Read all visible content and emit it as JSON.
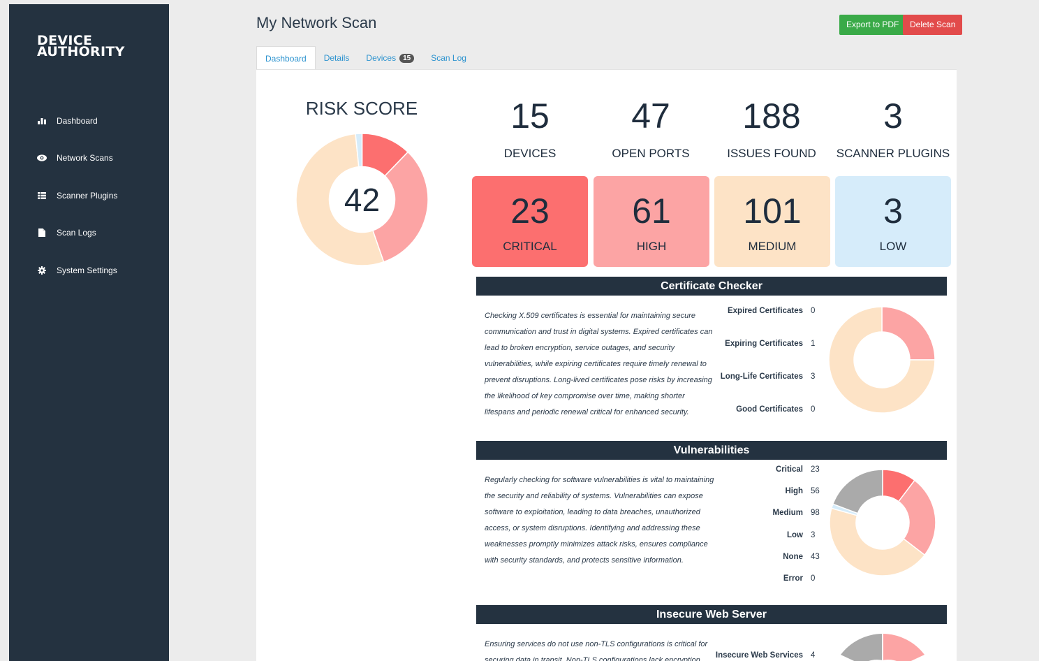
{
  "app": {
    "logo_line1": "DEVICE",
    "logo_line2": "AUTHORITY"
  },
  "sidebar": {
    "items": [
      {
        "label": "Dashboard",
        "icon": "bar-chart-icon"
      },
      {
        "label": "Network Scans",
        "icon": "eye-icon"
      },
      {
        "label": "Scanner Plugins",
        "icon": "list-icon"
      },
      {
        "label": "Scan Logs",
        "icon": "file-icon"
      },
      {
        "label": "System Settings",
        "icon": "gear-icon"
      }
    ]
  },
  "header": {
    "title": "My Network Scan",
    "export_label": "Export to PDF",
    "delete_label": "Delete Scan"
  },
  "tabs": [
    {
      "label": "Dashboard",
      "active": true
    },
    {
      "label": "Details"
    },
    {
      "label": "Devices",
      "badge": "15"
    },
    {
      "label": "Scan Log"
    }
  ],
  "risk": {
    "title": "RISK SCORE",
    "value": "42"
  },
  "stats": [
    {
      "value": "15",
      "label": "DEVICES"
    },
    {
      "value": "47",
      "label": "OPEN PORTS"
    },
    {
      "value": "188",
      "label": "ISSUES FOUND"
    },
    {
      "value": "3",
      "label": "SCANNER PLUGINS"
    }
  ],
  "severity": [
    {
      "value": "23",
      "label": "CRITICAL",
      "color": "#fc6f6f"
    },
    {
      "value": "61",
      "label": "HIGH",
      "color": "#fca4a4"
    },
    {
      "value": "101",
      "label": "MEDIUM",
      "color": "#fde3c6"
    },
    {
      "value": "3",
      "label": "LOW",
      "color": "#d6ecfa"
    }
  ],
  "colors": {
    "critical": "#fc6f6f",
    "high": "#fca4a4",
    "medium": "#fde3c6",
    "low": "#d6ecfa",
    "none": "#aaaaaa",
    "sidebar": "#243240",
    "accent": "#2c93cf"
  },
  "sections": {
    "cert": {
      "title": "Certificate Checker",
      "description": "Checking X.509 certificates is essential for maintaining secure communication and trust in digital systems. Expired certificates can lead to broken encryption, service outages, and security vulnerabilities, while expiring certificates require timely renewal to prevent disruptions. Long-lived certificates pose risks by increasing the likelihood of key compromise over time, making shorter lifespans and periodic renewal critical for enhanced security.",
      "items": [
        {
          "label": "Expired Certificates",
          "value": "0"
        },
        {
          "label": "Expiring Certificates",
          "value": "1"
        },
        {
          "label": "Long-Life Certificates",
          "value": "3"
        },
        {
          "label": "Good Certificates",
          "value": "0"
        }
      ]
    },
    "vuln": {
      "title": "Vulnerabilities",
      "description": "Regularly checking for software vulnerabilities is vital to maintaining the security and reliability of systems. Vulnerabilities can expose software to exploitation, leading to data breaches, unauthorized access, or system disruptions. Identifying and addressing these weaknesses promptly minimizes attack risks, ensures compliance with security standards, and protects sensitive information.",
      "items": [
        {
          "label": "Critical",
          "value": "23"
        },
        {
          "label": "High",
          "value": "56"
        },
        {
          "label": "Medium",
          "value": "98"
        },
        {
          "label": "Low",
          "value": "3"
        },
        {
          "label": "None",
          "value": "43"
        },
        {
          "label": "Error",
          "value": "0"
        }
      ]
    },
    "web": {
      "title": "Insecure Web Server",
      "description": "Ensuring services do not use non-TLS configurations is critical for securing data in transit. Non-TLS configurations lack encryption",
      "items": [
        {
          "label": "Insecure Web Services",
          "value": "4"
        }
      ]
    }
  },
  "chart_data": [
    {
      "type": "pie",
      "title": "RISK SCORE",
      "categories": [
        "Critical",
        "High",
        "Medium",
        "Low"
      ],
      "values": [
        23,
        61,
        101,
        3
      ]
    },
    {
      "type": "pie",
      "title": "Certificate Checker",
      "categories": [
        "Expired Certificates",
        "Expiring Certificates",
        "Long-Life Certificates",
        "Good Certificates"
      ],
      "values": [
        0,
        1,
        3,
        0
      ]
    },
    {
      "type": "pie",
      "title": "Vulnerabilities",
      "categories": [
        "Critical",
        "High",
        "Medium",
        "Low",
        "None",
        "Error"
      ],
      "values": [
        23,
        56,
        98,
        3,
        43,
        0
      ]
    }
  ]
}
